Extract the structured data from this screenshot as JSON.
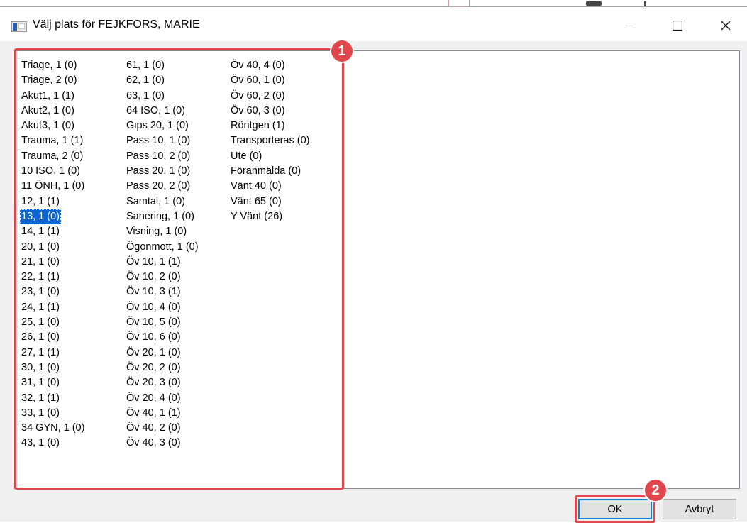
{
  "window": {
    "title": "Välj plats för FEJKFORS, MARIE",
    "controls": {
      "minimize": "—",
      "maximize": "☐",
      "close": "✕"
    }
  },
  "locations": {
    "columns": [
      [
        "Triage, 1 (0)",
        "Triage, 2 (0)",
        "Akut1, 1 (1)",
        "Akut2, 1 (0)",
        "Akut3, 1 (0)",
        "Trauma, 1 (1)",
        "Trauma, 2 (0)",
        "10 ISO, 1 (0)",
        "11 ÖNH, 1 (0)",
        "12, 1 (1)",
        "13, 1 (0)",
        "14, 1 (1)",
        "20, 1 (0)",
        "21, 1 (0)",
        "22, 1 (1)",
        "23, 1 (0)",
        "24, 1 (1)",
        "25, 1 (0)",
        "26, 1 (0)",
        "27, 1 (1)",
        "30, 1 (0)",
        "31, 1 (0)",
        "32, 1 (1)",
        "33, 1 (0)",
        "34 GYN, 1 (0)",
        "43, 1 (0)"
      ],
      [
        "61, 1 (0)",
        "62, 1 (0)",
        "63, 1 (0)",
        "64 ISO, 1 (0)",
        "Gips 20, 1 (0)",
        "Pass 10, 1 (0)",
        "Pass 10, 2 (0)",
        "Pass 20, 1 (0)",
        "Pass 20, 2 (0)",
        "Samtal, 1 (0)",
        "Sanering, 1 (0)",
        "Visning, 1 (0)",
        "Ögonmott, 1 (0)",
        "Öv 10, 1 (1)",
        "Öv 10, 2 (0)",
        "Öv 10, 3 (1)",
        "Öv 10, 4 (0)",
        "Öv 10, 5 (0)",
        "Öv 10, 6 (0)",
        "Öv 20, 1 (0)",
        "Öv 20, 2 (0)",
        "Öv 20, 3 (0)",
        "Öv 20, 4 (0)",
        "Öv 40, 1 (1)",
        "Öv 40, 2 (0)",
        "Öv 40, 3 (0)"
      ],
      [
        "Öv 40, 4 (0)",
        "Öv 60, 1 (0)",
        "Öv 60, 2 (0)",
        "Öv 60, 3 (0)",
        "Röntgen (1)",
        "Transporteras (0)",
        "Ute (0)",
        "Föranmälda (0)",
        "Vänt 40 (0)",
        "Vänt 65 (0)",
        "Y Vänt (26)"
      ]
    ],
    "selected": "13, 1 (0)"
  },
  "buttons": {
    "ok": "OK",
    "cancel": "Avbryt"
  },
  "annotations": {
    "badge_1": "1",
    "badge_2": "2"
  },
  "colors": {
    "highlight": "#e0464b",
    "selection": "#0a64d2"
  }
}
